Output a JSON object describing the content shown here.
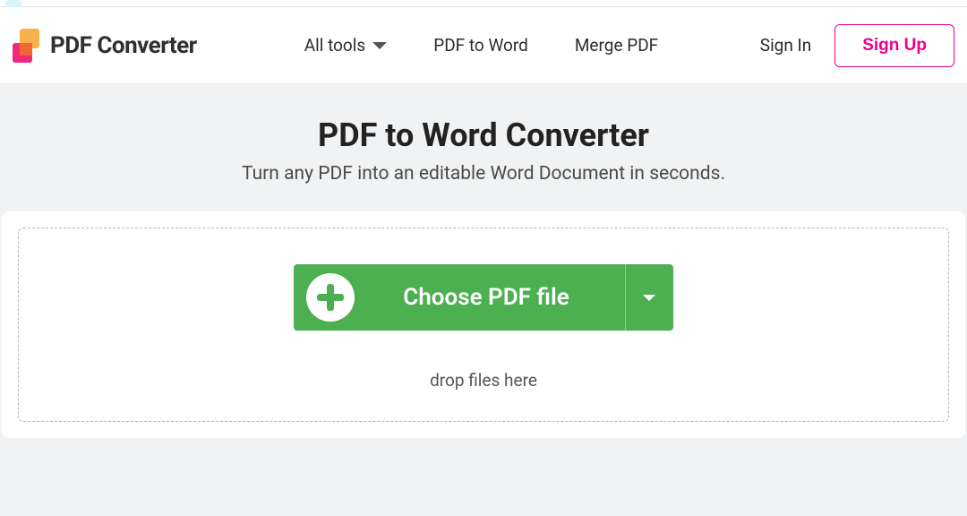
{
  "brand": {
    "name": "PDF Converter"
  },
  "nav": {
    "all_tools": "All tools",
    "pdf_to_word": "PDF to Word",
    "merge_pdf": "Merge PDF"
  },
  "auth": {
    "sign_in": "Sign In",
    "sign_up": "Sign Up"
  },
  "hero": {
    "title": "PDF to Word Converter",
    "subtitle": "Turn any PDF into an editable Word Document in seconds."
  },
  "upload": {
    "choose_label": "Choose PDF file",
    "drop_text": "drop files here"
  },
  "colors": {
    "accent_pink": "#ec008c",
    "accent_green": "#4caf50"
  }
}
